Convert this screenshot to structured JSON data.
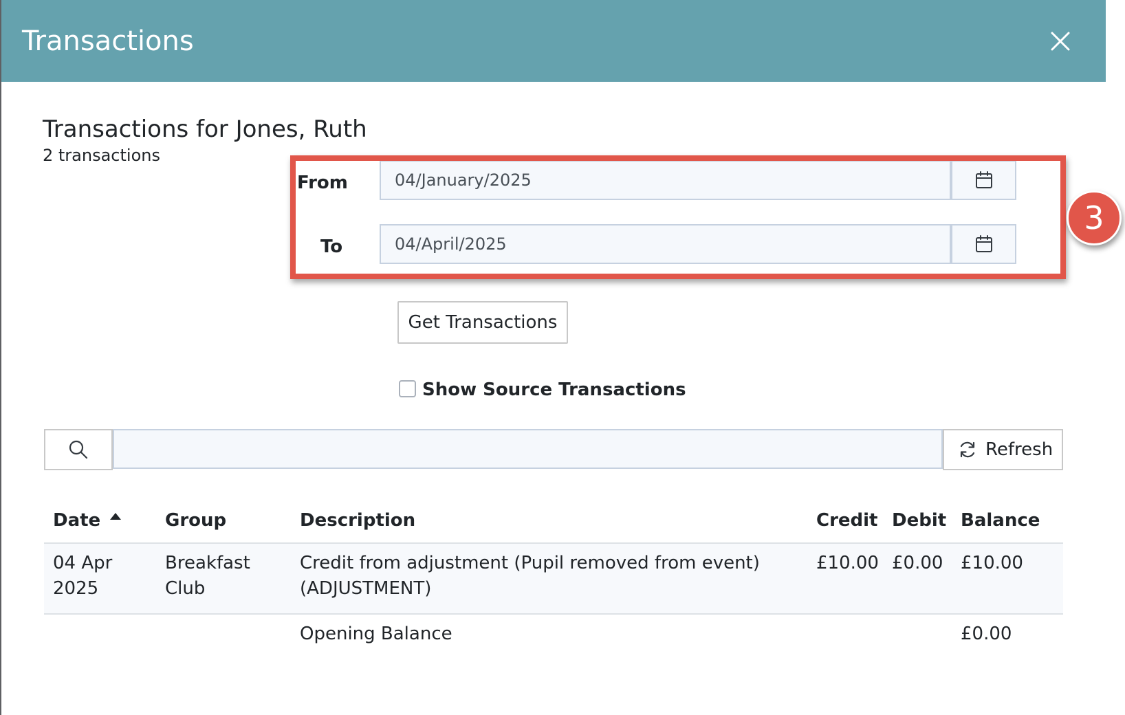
{
  "modal": {
    "title": "Transactions",
    "close_icon": "close-icon"
  },
  "page": {
    "title": "Transactions for Jones, Ruth",
    "count": "2 transactions"
  },
  "filters": {
    "from_label": "From",
    "from_value": "04/January/2025",
    "to_label": "To",
    "to_value": "04/April/2025",
    "calendar_icon": "calendar-icon",
    "get_button": "Get Transactions",
    "show_source_label": "Show Source Transactions",
    "show_source_checked": false
  },
  "annotation": {
    "step_number": "3",
    "color": "#e1564a"
  },
  "search": {
    "icon": "search-icon",
    "value": "",
    "refresh_label": "Refresh",
    "refresh_icon": "refresh-icon"
  },
  "table": {
    "columns": [
      "Date",
      "Group",
      "Description",
      "Credit",
      "Debit",
      "Balance"
    ],
    "sort_column": "Date",
    "sort_direction": "ascending",
    "rows": [
      {
        "date_line1": "04 Apr",
        "date_line2": "2025",
        "group_line1": "Breakfast",
        "group_line2": "Club",
        "description_line1": "Credit from adjustment (Pupil removed from event)",
        "description_line2": "(ADJUSTMENT)",
        "credit": "£10.00",
        "debit": "£0.00",
        "balance": "£10.00"
      }
    ],
    "opening_balance": {
      "label": "Opening Balance",
      "balance": "£0.00"
    }
  },
  "colors": {
    "header_bg": "#65a2ae",
    "annotation": "#e1564a",
    "input_bg": "#f5f8fc"
  }
}
